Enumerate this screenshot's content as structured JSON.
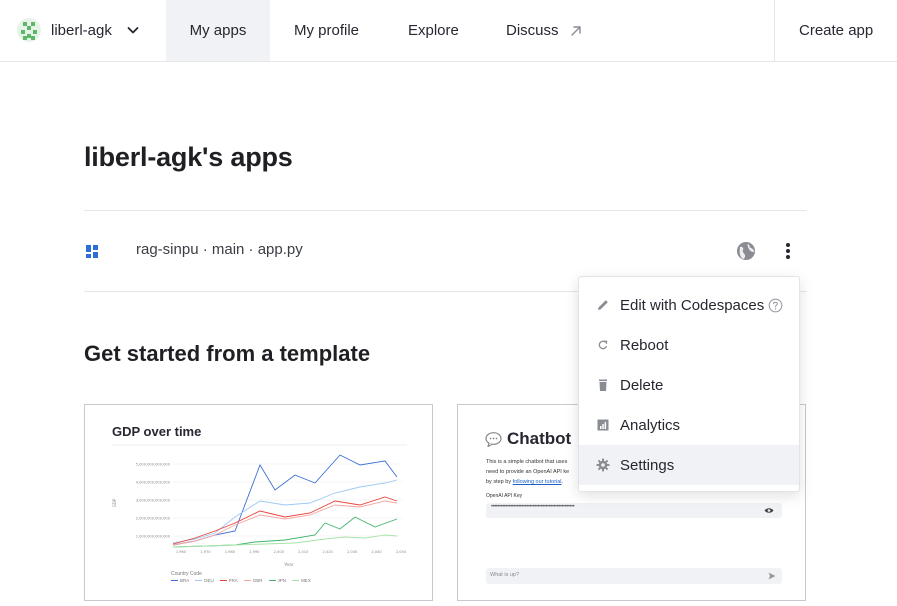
{
  "nav": {
    "workspace_name": "liberl-agk",
    "tabs": [
      "My apps",
      "My profile",
      "Explore",
      "Discuss"
    ],
    "create_app": "Create app"
  },
  "page": {
    "title": "liberl-agk's apps"
  },
  "apps": [
    {
      "label": "rag-sinpu · main · app.py"
    }
  ],
  "menu": {
    "items": [
      "Edit with Codespaces",
      "Reboot",
      "Delete",
      "Analytics",
      "Settings"
    ],
    "hovered": "Settings"
  },
  "templates": {
    "title": "Get started from a template",
    "gdp": {
      "title": "GDP over time",
      "y_ticks": [
        "5,000,000,000,000",
        "4,000,000,000,000",
        "3,000,000,000,000",
        "2,000,000,000,000",
        "1,000,000,000,000"
      ],
      "x_ticks": [
        "1,960",
        "1,970",
        "1,980",
        "1,990",
        "2,000",
        "2,010",
        "2,020",
        "2,030",
        "2,040",
        "2,050"
      ],
      "ylabel": "GDP",
      "xlabel": "Year",
      "legend_title": "Country Code",
      "legend": [
        {
          "code": "BRA",
          "color": "#3b6fd4"
        },
        {
          "code": "DEU",
          "color": "#9ec8f5"
        },
        {
          "code": "FRA",
          "color": "#e8453c"
        },
        {
          "code": "GBR",
          "color": "#f4a6a0"
        },
        {
          "code": "JPN",
          "color": "#3fb56c"
        },
        {
          "code": "MEX",
          "color": "#a6e3a8"
        }
      ]
    },
    "chatbot": {
      "title": "Chatbot",
      "description_1": "This is a simple chatbot that uses",
      "description_2": "need to provide an OpenAI API ke",
      "description_3": "by step by",
      "description_link": "following our tutorial",
      "api_label": "OpenAI API Key",
      "api_value": "••••••••••••••••••••••••••••••••••••••••••••••••••••",
      "chat_placeholder": "What is up?"
    }
  },
  "colors": {
    "accent": "#2d6fd6",
    "hover_bg": "#f0f2f6",
    "border": "#e6e6ea"
  }
}
